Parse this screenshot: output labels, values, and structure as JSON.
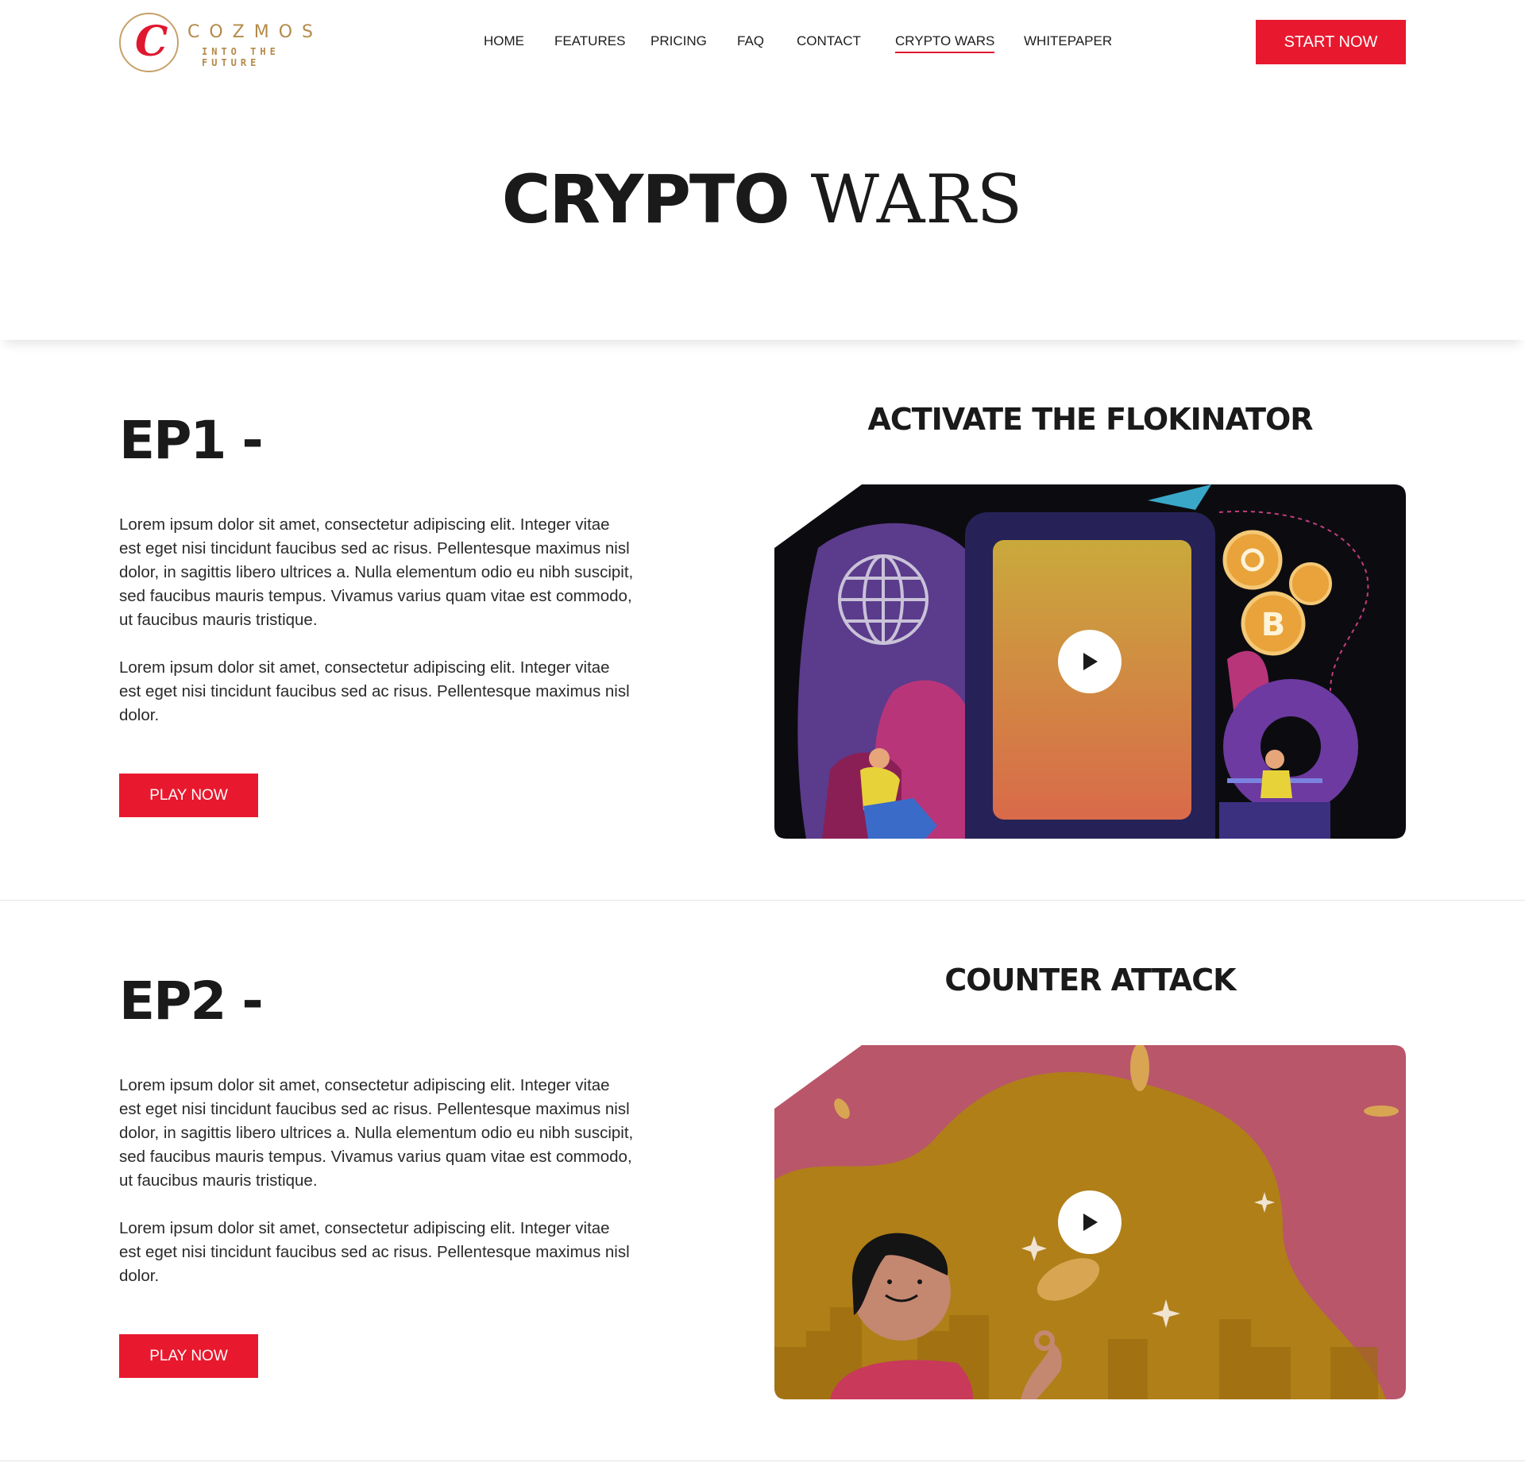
{
  "brand": {
    "logo_letter": "C",
    "name": "COZMOS",
    "tagline": "INTO THE FUTURE",
    "accent_color": "#e8192e",
    "gold_color": "#b48a4a"
  },
  "nav": {
    "items": [
      {
        "label": "HOME"
      },
      {
        "label": "FEATURES"
      },
      {
        "label": "PRICING"
      },
      {
        "label": "FAQ"
      },
      {
        "label": "CONTACT"
      },
      {
        "label": "CRYPTO WARS",
        "active": true
      },
      {
        "label": "WHITEPAPER"
      }
    ],
    "cta_label": "START NOW"
  },
  "hero": {
    "title_bold": "CRYPTO",
    "title_thin": "WARS"
  },
  "episodes": [
    {
      "label": "EP1  -",
      "title": "ACTIVATE THE FLOKINATOR",
      "paragraph_1": "Lorem ipsum dolor sit amet, consectetur adipiscing elit. Integer vitae est eget nisi tincidunt faucibus sed ac risus. Pellentesque maximus nisl dolor, in sagittis libero ultrices a. Nulla elementum odio eu nibh suscipit, sed faucibus mauris tempus. Vivamus varius quam vitae est commodo, ut faucibus mauris tristique.",
      "paragraph_2": "Lorem ipsum dolor sit amet, consectetur adipiscing elit. Integer vitae est eget nisi tincidunt faucibus sed ac risus. Pellentesque maximus nisl dolor.",
      "button_label": "PLAY NOW",
      "video_icon": "play-icon"
    },
    {
      "label": "EP2  -",
      "title": "COUNTER ATTACK",
      "paragraph_1": "Lorem ipsum dolor sit amet, consectetur adipiscing elit. Integer vitae est eget nisi tincidunt faucibus sed ac risus. Pellentesque maximus nisl dolor, in sagittis libero ultrices a. Nulla elementum odio eu nibh suscipit, sed faucibus mauris tempus. Vivamus varius quam vitae est commodo, ut faucibus mauris tristique.",
      "paragraph_2": "Lorem ipsum dolor sit amet, consectetur adipiscing elit. Integer vitae est eget nisi tincidunt faucibus sed ac risus. Pellentesque maximus nisl dolor.",
      "button_label": "PLAY NOW",
      "video_icon": "play-icon"
    }
  ]
}
